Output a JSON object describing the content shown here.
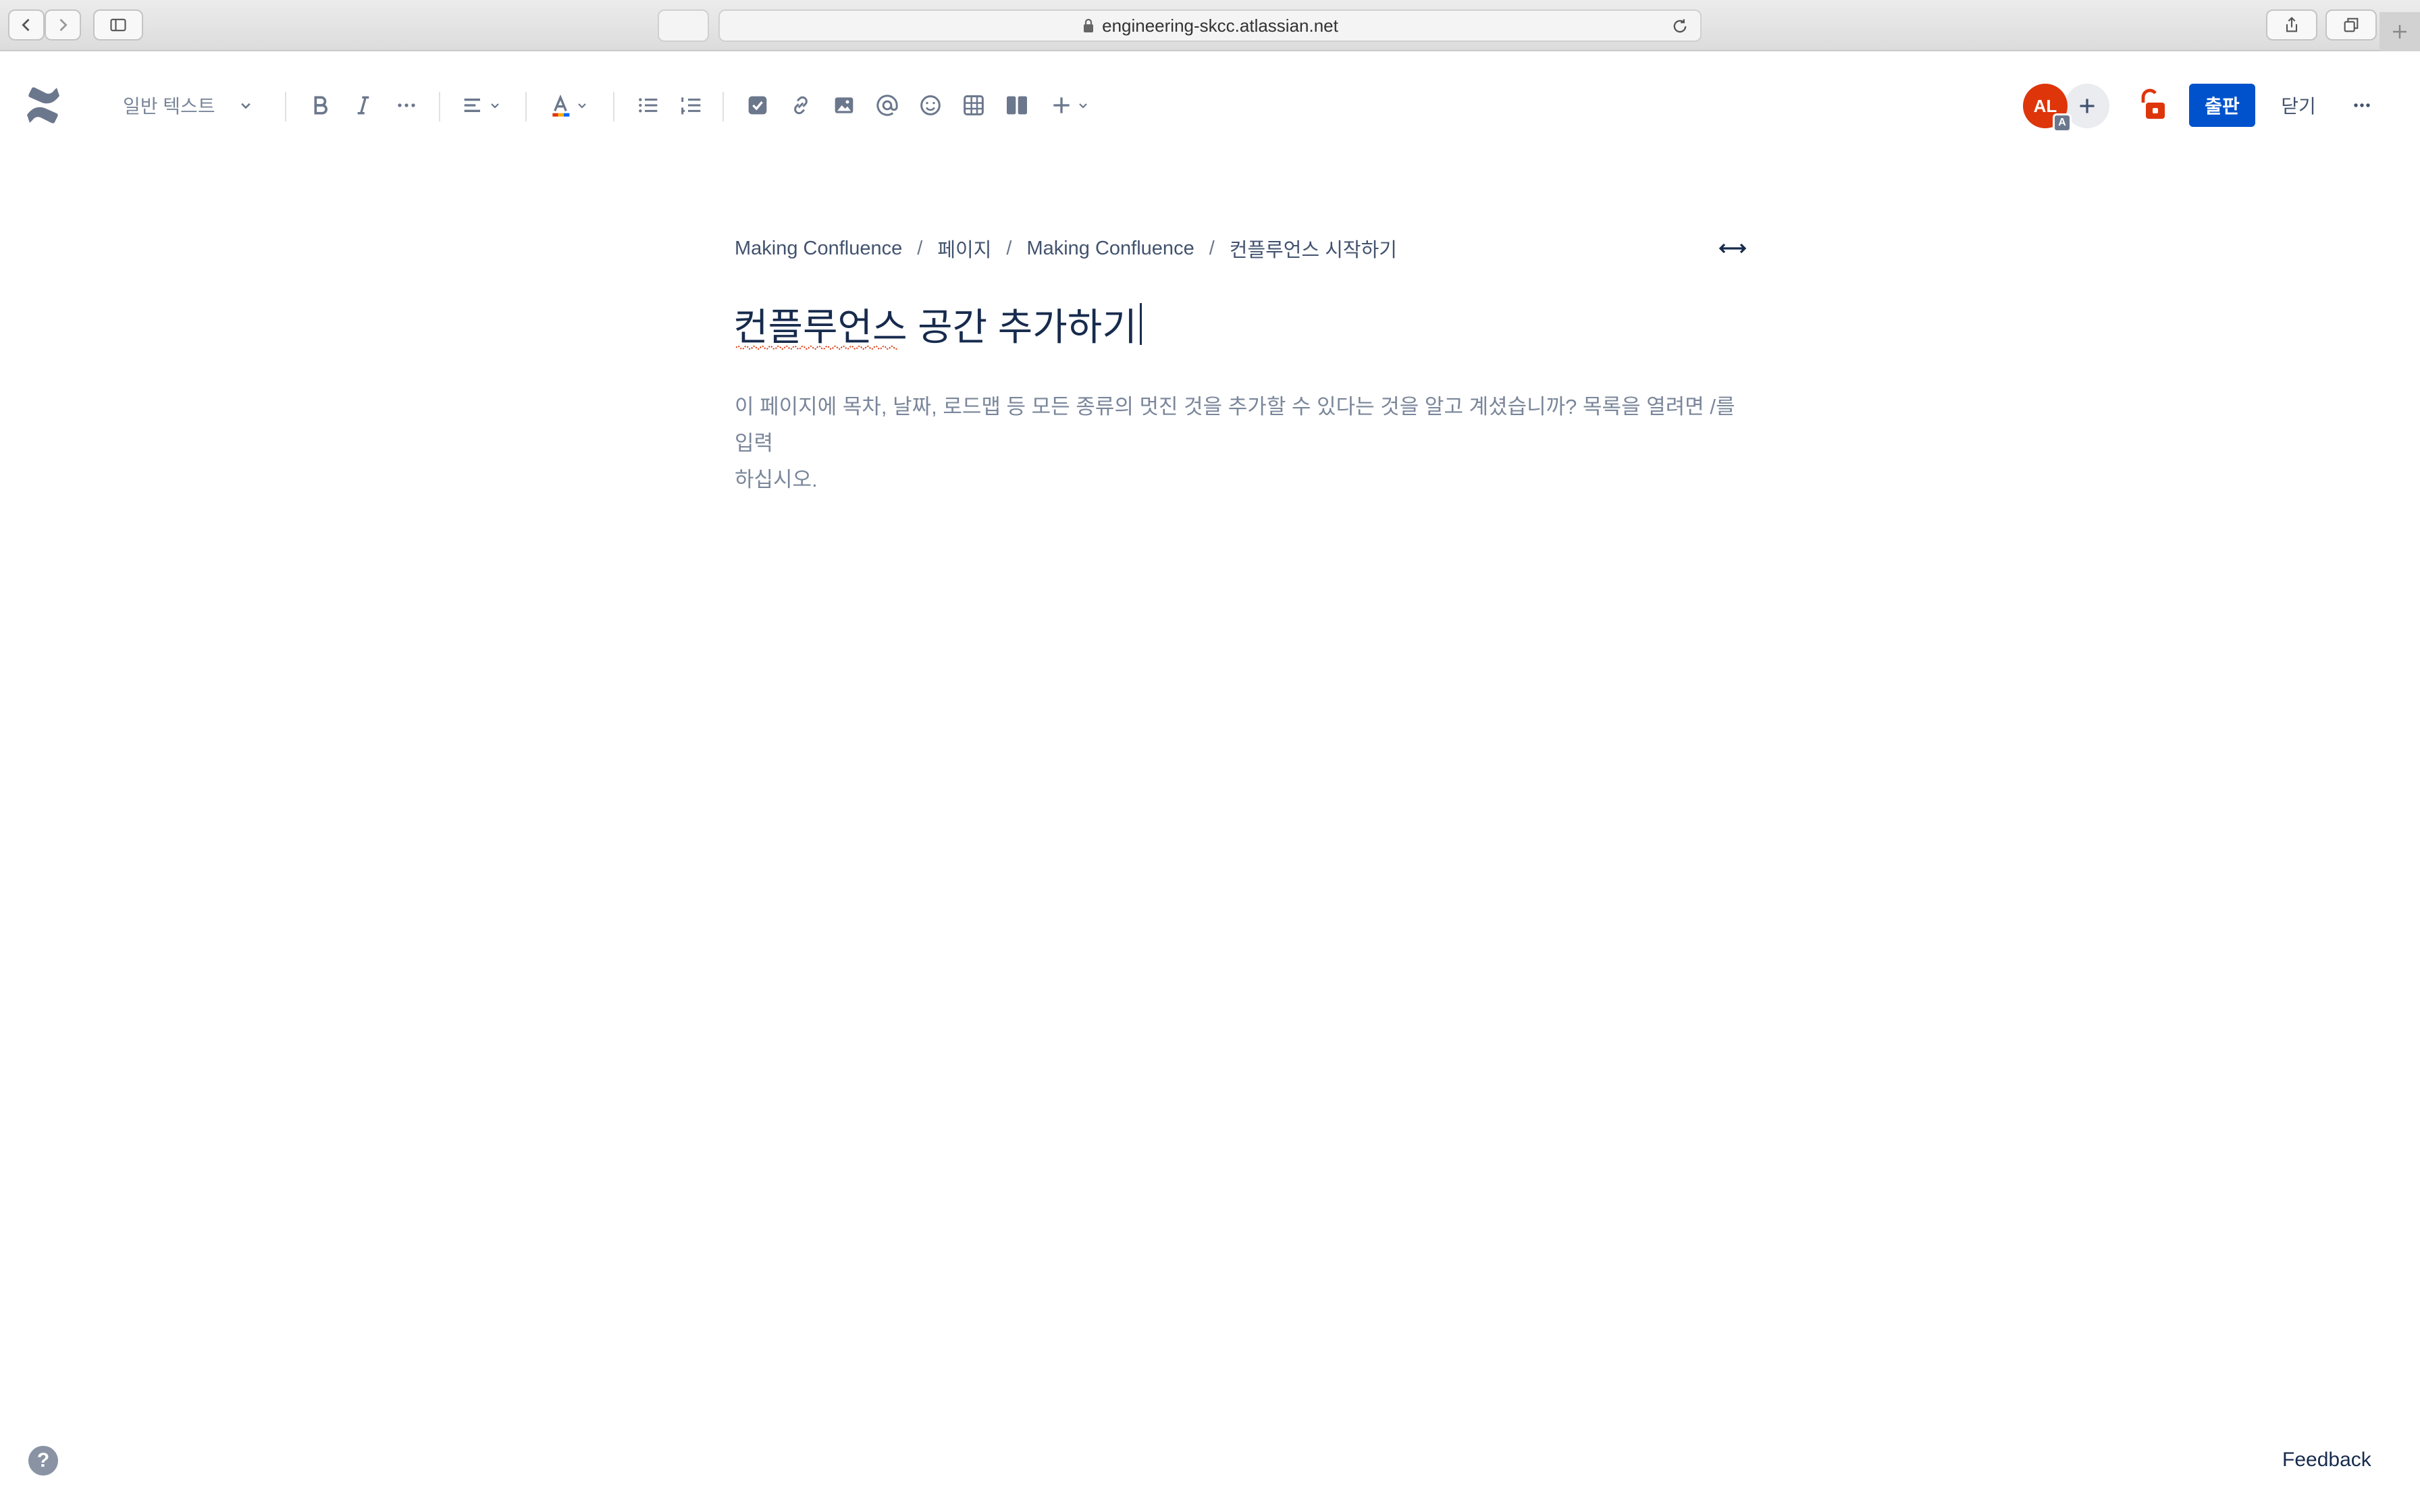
{
  "browser": {
    "url": "engineering-skcc.atlassian.net"
  },
  "toolbar": {
    "text_style": "일반 텍스트",
    "user_initials": "AL",
    "user_badge": "A",
    "publish_label": "출판",
    "close_label": "닫기"
  },
  "breadcrumb": {
    "items": [
      "Making Confluence",
      "페이지",
      "Making Confluence",
      "컨플루언스 시작하기"
    ],
    "separator": "/"
  },
  "page": {
    "title": "컨플루언스 공간 추가하기",
    "placeholder_line1": "이 페이지에 목차, 날짜, 로드맵 등 모든 종류의 멋진 것을 추가할 수 있다는 것을 알고 계셨습니까? 목록을 열려면 /를 입력",
    "placeholder_line2": "하십시오."
  },
  "footer": {
    "help_symbol": "?",
    "feedback_label": "Feedback"
  },
  "colors": {
    "publish": "#0052cc",
    "avatar": "#de350b",
    "restriction": "#de350b",
    "text": "#172b4d",
    "muted": "#7a869a"
  }
}
